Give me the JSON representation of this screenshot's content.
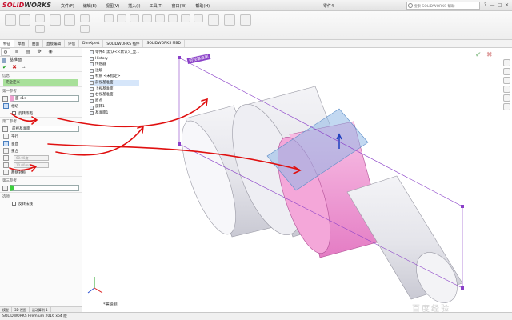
{
  "app": {
    "logo_brand": "SOLID",
    "logo_rest": "WORKS",
    "menu": [
      "文件(F)",
      "编辑(E)",
      "视图(V)",
      "插入(I)",
      "工具(T)",
      "窗口(W)",
      "帮助(H)"
    ],
    "doc_title": "零件4",
    "search_placeholder": "搜索 SOLIDWORKS 帮助",
    "window_controls": [
      "?",
      "—",
      "□",
      "✕"
    ]
  },
  "tabs": [
    "特征",
    "草图",
    "曲面",
    "直接编辑",
    "评估",
    "DimXpert",
    "SOLIDWORKS 插件",
    "SOLIDWORKS MBD"
  ],
  "active_tab_index": 0,
  "property_manager": {
    "title": "基准面",
    "message_header": "信息",
    "message": "完全定义",
    "first_ref": {
      "header": "第一参考",
      "selection": "面<1>",
      "options": [
        "相切",
        "反转等距"
      ]
    },
    "second_ref": {
      "header": "第二参考",
      "selection": "前视基准面",
      "options": [
        "平行",
        "垂直",
        "重合"
      ],
      "angle": "60.00度",
      "distance": "10.00mm",
      "mid_plane": "两侧对称"
    },
    "third_ref": {
      "header": "第三参考",
      "selection": ""
    },
    "options": {
      "header": "选项",
      "flip_normal": "反转法线"
    }
  },
  "feature_tree": [
    {
      "label": "零件4 (默认<<默认>_显...",
      "highlight": false
    },
    {
      "label": "History",
      "highlight": false
    },
    {
      "label": "传感器",
      "highlight": false
    },
    {
      "label": "注解",
      "highlight": false
    },
    {
      "label": "材质 <未指定>",
      "highlight": false
    },
    {
      "label": "前视基准面",
      "highlight": true
    },
    {
      "label": "上视基准面",
      "highlight": false
    },
    {
      "label": "右视基准面",
      "highlight": false
    },
    {
      "label": "原点",
      "highlight": false
    },
    {
      "label": "旋转1",
      "highlight": false
    },
    {
      "label": "基准面1",
      "highlight": false
    }
  ],
  "viewport": {
    "plane_label": "前视基准面",
    "view_label": "*等轴测",
    "accent_plane_color": "#9fc3ea",
    "face_highlight_color": "#f28fd2",
    "annotation_arrow_color": "#e01010"
  },
  "bottom_tabs": [
    "模型",
    "3D 视图",
    "运动算例 1"
  ],
  "status_bar": "SOLIDWORKS Premium 2016 x64 版",
  "watermark": "百度经验"
}
